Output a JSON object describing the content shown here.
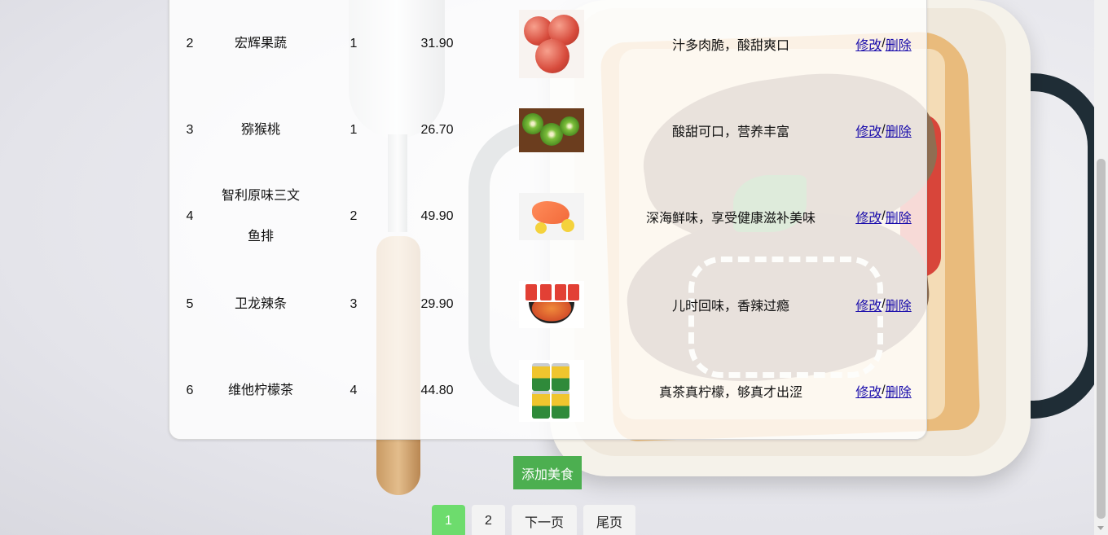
{
  "rows": [
    {
      "id": "2",
      "name_lines": [
        "宏辉果蔬"
      ],
      "qty": "1",
      "price": "31.90",
      "image": "apple-photo",
      "desc": "汁多肉脆，酸甜爽口",
      "edit": "修改",
      "sep": "/",
      "delete": "删除"
    },
    {
      "id": "3",
      "name_lines": [
        "猕猴桃"
      ],
      "qty": "1",
      "price": "26.70",
      "image": "kiwi-photo",
      "desc": "酸甜可口，营养丰富",
      "edit": "修改",
      "sep": "/",
      "delete": "删除"
    },
    {
      "id": "4",
      "name_lines": [
        "智利原味三文",
        "鱼排"
      ],
      "qty": "2",
      "price": "49.90",
      "image": "salmon-photo",
      "desc": "深海鲜味，享受健康滋补美味",
      "edit": "修改",
      "sep": "/",
      "delete": "删除"
    },
    {
      "id": "5",
      "name_lines": [
        "卫龙辣条"
      ],
      "qty": "3",
      "price": "29.90",
      "image": "latiao-photo",
      "desc": "儿时回味，香辣过瘾",
      "edit": "修改",
      "sep": "/",
      "delete": "删除"
    },
    {
      "id": "6",
      "name_lines": [
        "维他柠檬茶"
      ],
      "qty": "4",
      "price": "44.80",
      "image": "lemon-tea-photo",
      "desc": "真茶真柠檬，够真才出涩",
      "edit": "修改",
      "sep": "/",
      "delete": "删除"
    }
  ],
  "add_button": "添加美食",
  "pagination": {
    "pages": [
      "1",
      "2"
    ],
    "current": "1",
    "next": "下一页",
    "last": "尾页"
  },
  "colors": {
    "add_button": "#4caf50",
    "active_page": "#6ddc6d",
    "link": "#1a0dab"
  }
}
